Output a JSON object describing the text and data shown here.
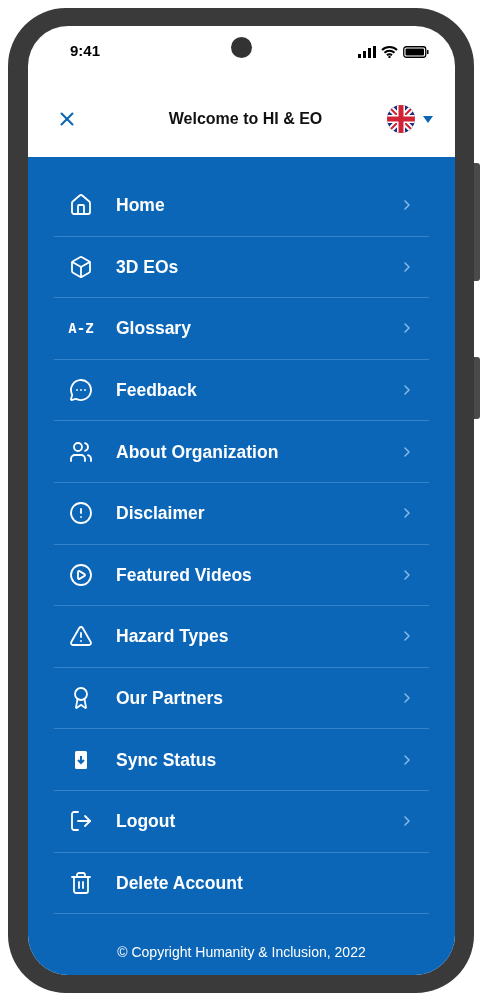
{
  "status_bar": {
    "time": "9:41"
  },
  "header": {
    "title": "Welcome to HI & EO"
  },
  "menu": [
    {
      "kind": "home",
      "label": "Home",
      "chevron": true
    },
    {
      "kind": "cube",
      "label": "3D EOs",
      "chevron": true
    },
    {
      "kind": "text",
      "icon_text": "A-Z",
      "label": "Glossary",
      "chevron": true
    },
    {
      "kind": "chat",
      "label": "Feedback",
      "chevron": true
    },
    {
      "kind": "people",
      "label": "About Organization",
      "chevron": true
    },
    {
      "kind": "alert",
      "label": "Disclaimer",
      "chevron": true
    },
    {
      "kind": "play",
      "label": "Featured Videos",
      "chevron": true
    },
    {
      "kind": "warning",
      "label": "Hazard Types",
      "chevron": true
    },
    {
      "kind": "award",
      "label": "Our Partners",
      "chevron": true
    },
    {
      "kind": "sync",
      "label": "Sync Status",
      "chevron": true
    },
    {
      "kind": "logout",
      "label": "Logout",
      "chevron": true
    },
    {
      "kind": "trash",
      "label": "Delete Account",
      "chevron": false
    }
  ],
  "footer": {
    "copyright": "© Copyright Humanity & Inclusion, 2022"
  }
}
